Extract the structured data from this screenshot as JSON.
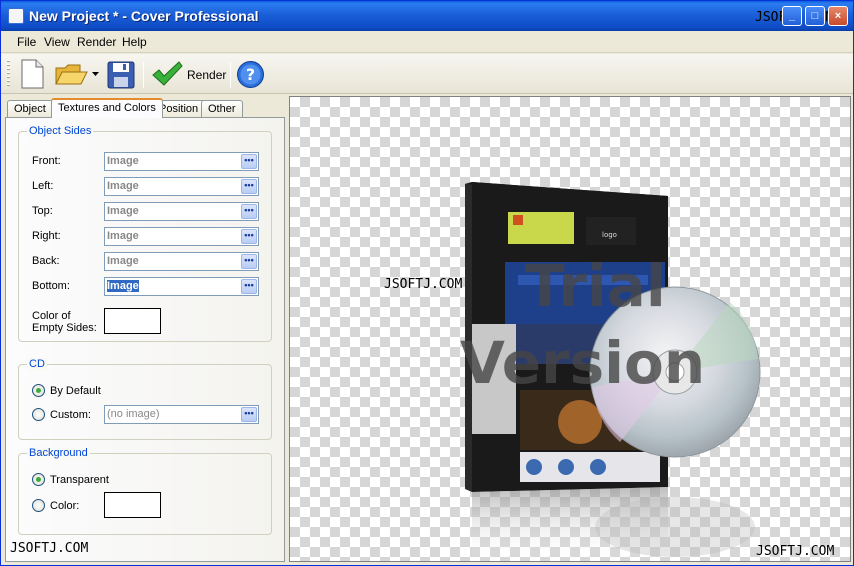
{
  "window": {
    "title": "New Project * - Cover Professional",
    "watermark": "JSOFTJ.COM",
    "controls": {
      "minimize": "_",
      "maximize": "□",
      "close": "×"
    }
  },
  "menu": [
    "File",
    "View",
    "Render",
    "Help"
  ],
  "toolbar": {
    "render_label": "Render",
    "icons": [
      "new-file-icon",
      "open-folder-icon",
      "dropdown-arrow-icon",
      "save-disk-icon",
      "render-check-icon",
      "help-icon"
    ]
  },
  "tabs": [
    "Object",
    "Textures and Colors",
    "Position",
    "Other"
  ],
  "active_tab": "Textures and Colors",
  "object_sides": {
    "title": "Object Sides",
    "sides": [
      {
        "label": "Front:",
        "value": "Image"
      },
      {
        "label": "Left:",
        "value": "Image"
      },
      {
        "label": "Top:",
        "value": "Image"
      },
      {
        "label": "Right:",
        "value": "Image"
      },
      {
        "label": "Back:",
        "value": "Image"
      },
      {
        "label": "Bottom:",
        "value": "Image"
      }
    ],
    "empty_color_label_1": "Color of",
    "empty_color_label_2": "Empty Sides:",
    "button_glyph": "•••"
  },
  "cd": {
    "title": "CD",
    "by_default_label": "By Default",
    "custom_label": "Custom:",
    "custom_value": "(no image)",
    "selected": "By Default"
  },
  "background": {
    "title": "Background",
    "transparent_label": "Transparent",
    "color_label": "Color:",
    "selected": "Transparent"
  },
  "canvas": {
    "watermark_center": "JSOFTJ.COM",
    "watermark_bottom_left": "JSOFTJ.COM",
    "watermark_bottom_right": "JSOFTJ.COM",
    "trial_line1": "Trial",
    "trial_line2": "Version"
  },
  "colors": {
    "titlebar": "#0a5fe0",
    "group_title": "#0046d5",
    "selection": "#316ac5",
    "active_tab_accent": "#e68b2c"
  }
}
